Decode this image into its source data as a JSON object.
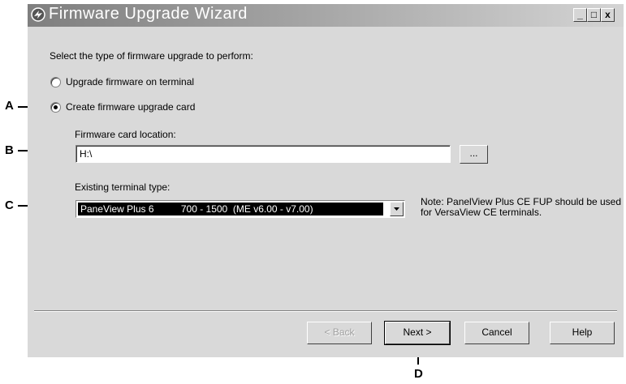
{
  "window": {
    "title": "Firmware Upgrade Wizard",
    "caption_buttons": {
      "minimize": "_",
      "maximize": "□",
      "close": "x"
    }
  },
  "prompt": "Select the type of firmware upgrade to perform:",
  "options": [
    {
      "label": "Upgrade firmware on terminal",
      "selected": false
    },
    {
      "label": "Create firmware upgrade card",
      "selected": true
    }
  ],
  "card_location": {
    "label": "Firmware card location:",
    "value": "H:\\",
    "browse_label": "..."
  },
  "terminal_type": {
    "label": "Existing terminal type:",
    "selected": "PaneView Plus 6          700 - 1500  (ME v6.00 - v7.00)"
  },
  "note": "Note: PanelView Plus CE FUP should be used for VersaView CE terminals.",
  "buttons": {
    "back": "< Back",
    "next": "Next >",
    "cancel": "Cancel",
    "help": "Help"
  },
  "callouts": {
    "a": "A",
    "b": "B",
    "c": "C",
    "d": "D"
  }
}
